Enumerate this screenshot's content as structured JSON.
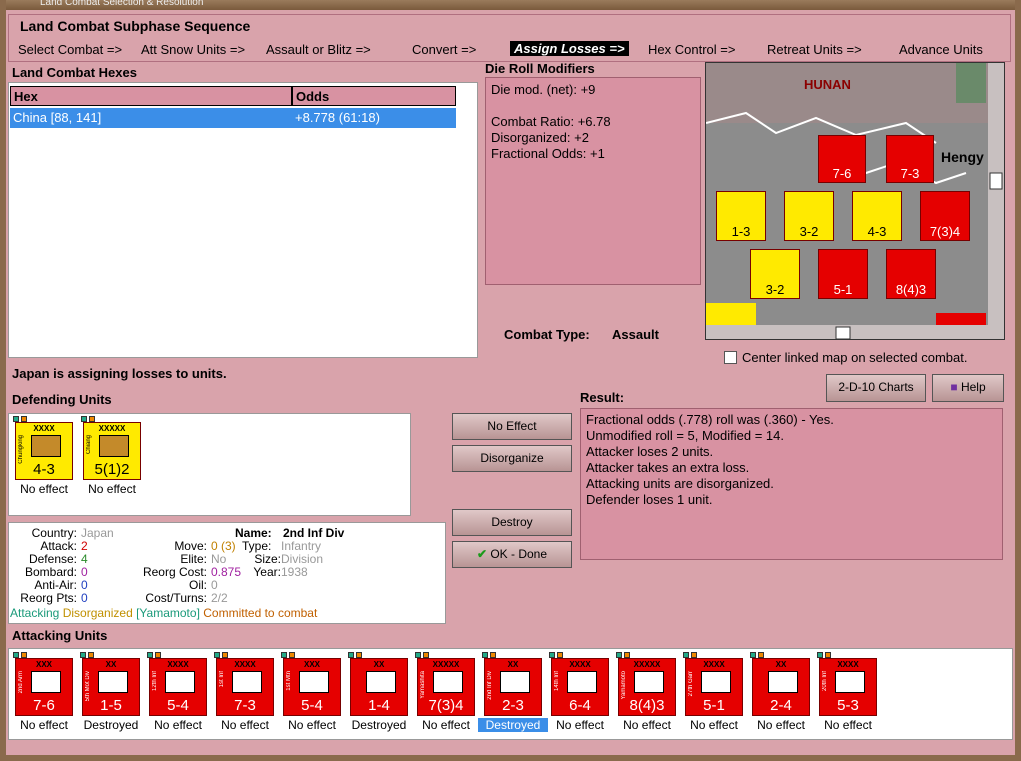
{
  "window_title": "Land Combat Selection & Resolution",
  "sequence": {
    "title": "Land Combat Subphase Sequence",
    "steps": [
      "Select Combat =>",
      "Att Snow Units =>",
      "Assault or Blitz =>",
      "Convert =>",
      "Assign Losses =>",
      "Hex Control =>",
      "Retreat Units =>",
      "Advance Units"
    ],
    "active": 4
  },
  "hexes": {
    "title": "Land Combat Hexes",
    "col_hex": "Hex",
    "col_odds": "Odds",
    "rows": [
      {
        "hex": "China [88, 141]",
        "odds": "+8.778 (61:18)"
      }
    ]
  },
  "drm": {
    "title": "Die Roll Modifiers",
    "lines": [
      "Die mod. (net): +9",
      "",
      "Combat Ratio: +6.78",
      "Disorganized: +2",
      "Fractional Odds: +1"
    ]
  },
  "combat_type": {
    "label": "Combat Type:",
    "value": "Assault"
  },
  "map": {
    "labels": [
      "HUNAN",
      "Hengy"
    ]
  },
  "center_map_label": "Center linked map on selected combat.",
  "buttons": {
    "charts": "2-D-10 Charts",
    "help": "Help",
    "no_effect": "No Effect",
    "disorganize": "Disorganize",
    "destroy": "Destroy",
    "ok": "OK - Done"
  },
  "status": "Japan is assigning losses to units.",
  "defending": {
    "title": "Defending Units",
    "units": [
      {
        "top": "XXXX",
        "side": "Chungking",
        "val": "4-3",
        "sym": "M",
        "status": "No effect"
      },
      {
        "top": "XXXXX",
        "side": "Chiang",
        "val": "5(1)2",
        "sym": "",
        "status": "No effect"
      }
    ]
  },
  "info": {
    "country_label": "Country:",
    "country": "Japan",
    "name_label": "Name:",
    "name": "2nd Inf Div",
    "attack_label": "Attack:",
    "attack": "2",
    "move_label": "Move:",
    "move": "0 (3)",
    "type_label": "Type:",
    "type": "Infantry",
    "defense_label": "Defense:",
    "defense": "4",
    "elite_label": "Elite:",
    "elite": "No",
    "size_label": "Size:",
    "size": "Division",
    "bombard_label": "Bombard:",
    "bombard": "0",
    "reorg_label": "Reorg Cost:",
    "reorg": "0.875",
    "year_label": "Year:",
    "year": "1938",
    "aa_label": "Anti-Air:",
    "aa": "0",
    "oil_label": "Oil:",
    "oil": "0",
    "rp_label": "Reorg Pts:",
    "rp": "0",
    "ct_label": "Cost/Turns:",
    "ct": "2/2",
    "tags": [
      "Attacking",
      "Disorganized",
      "[Yamamoto]",
      "Committed to combat"
    ]
  },
  "result": {
    "title": "Result:",
    "lines": [
      "Fractional odds (.778) roll was (.360)  - Yes.",
      "Unmodified roll = 5, Modified = 14.",
      "Attacker loses 2 units.",
      "Attacker takes an extra loss.",
      "Attacking units are disorganized.",
      "Defender loses 1 unit."
    ]
  },
  "attacking": {
    "title": "Attacking Units",
    "units": [
      {
        "top": "XXX",
        "side": "2nd Arm",
        "val": "7-6",
        "status": "No effect"
      },
      {
        "top": "XX",
        "side": "5th Mot Div",
        "val": "1-5",
        "status": "Destroyed"
      },
      {
        "top": "XXXX",
        "side": "12th Inf",
        "val": "5-4",
        "status": "No effect"
      },
      {
        "top": "XXXX",
        "side": "1st Inf",
        "val": "7-3",
        "status": "No effect"
      },
      {
        "top": "XXX",
        "side": "1st Mtn",
        "val": "5-4",
        "status": "No effect"
      },
      {
        "top": "XX",
        "side": "",
        "val": "1-4",
        "status": "Destroyed"
      },
      {
        "top": "XXXXX",
        "side": "Yamashita",
        "val": "7(3)4",
        "status": "No effect"
      },
      {
        "top": "XX",
        "side": "2nd Inf Div",
        "val": "2-3",
        "status": "Destroyed"
      },
      {
        "top": "XXXX",
        "side": "14th Inf",
        "val": "6-4",
        "status": "No effect"
      },
      {
        "top": "XXXXX",
        "side": "Yamamoto",
        "val": "8(4)3",
        "status": "No effect"
      },
      {
        "top": "XXXX",
        "side": "27th Garr",
        "val": "5-1",
        "status": "No effect"
      },
      {
        "top": "XX",
        "side": "",
        "val": "2-4",
        "status": "No effect"
      },
      {
        "top": "XXXX",
        "side": "20th Inf",
        "val": "5-3",
        "status": "No effect"
      }
    ],
    "selected": 7
  },
  "colors": {
    "red_unit": "#e50000",
    "yellow_unit": "#ffea00",
    "panel": "#d892a2",
    "selection": "#3b8ee8"
  }
}
